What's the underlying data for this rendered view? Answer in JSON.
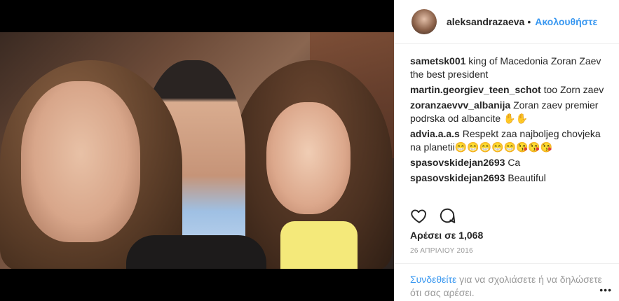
{
  "header": {
    "username": "aleksandrazaeva",
    "separator": "•",
    "follow_label": "Ακολουθήστε"
  },
  "comments": [
    {
      "user": "sametsk001",
      "text": "king of Macedonia Zoran Zaev the best president"
    },
    {
      "user": "martin.georgiev_teen_schot",
      "text": "too Zorn zaev"
    },
    {
      "user": "zoranzaevvv_albanija",
      "text": "Zoran zaev premier podrska od albancite ✋✋"
    },
    {
      "user": "advia.a.a.s",
      "text": "Respekt zaa najboljeg chovjeka na planetii😁😁😁😁😁😘😘😘"
    },
    {
      "user": "spasovskidejan2693",
      "text": "Ca"
    },
    {
      "user": "spasovskidejan2693",
      "text": "Beautiful"
    }
  ],
  "actions": {
    "like_icon": "heart-icon",
    "comment_icon": "comment-icon"
  },
  "likes_text": "Αρέσει σε 1,068",
  "date_text": "26 ΑΠΡΙΛΙΟΥ 2016",
  "login_prompt": {
    "link_label": "Συνδεθείτε",
    "rest_text": " για να σχολιάσετε ή να δηλώσετε ότι σας αρέσει."
  },
  "more_label": "•••",
  "colors": {
    "accent": "#3897f0",
    "text": "#262626",
    "muted": "#999999",
    "photo_background": "#000000"
  }
}
